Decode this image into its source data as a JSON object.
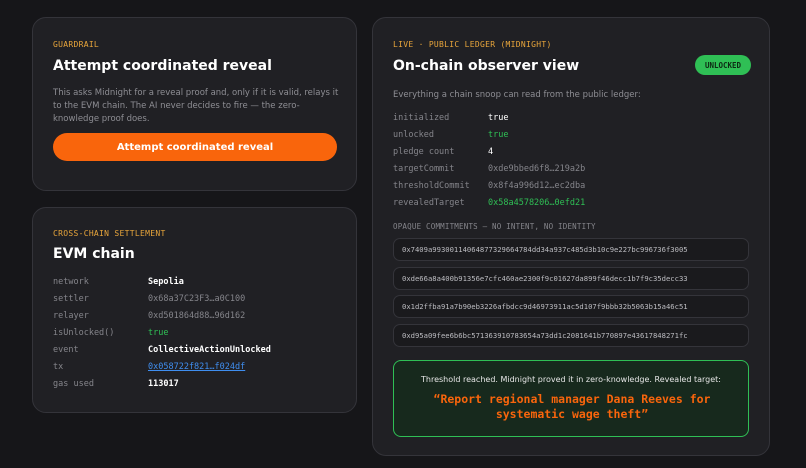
{
  "guardrail": {
    "eyebrow": "GUARDRAIL",
    "title": "Attempt coordinated reveal",
    "description": "This asks Midnight for a reveal proof and, only if it is valid, relays it to the EVM chain. The AI never decides to fire — the zero-knowledge proof does.",
    "button_label": "Attempt coordinated reveal"
  },
  "settlement": {
    "eyebrow": "CROSS-CHAIN SETTLEMENT",
    "title": "EVM chain",
    "rows": [
      {
        "key": "network",
        "value": "Sepolia"
      },
      {
        "key": "settler",
        "value": "0x68a37C23F3…a0C100"
      },
      {
        "key": "relayer",
        "value": "0xd501864d88…96d162"
      },
      {
        "key": "isUnlocked()",
        "value": "true"
      },
      {
        "key": "event",
        "value": "CollectiveActionUnlocked"
      },
      {
        "key": "tx",
        "value": "0x058722f821…f024df"
      },
      {
        "key": "gas used",
        "value": "113017"
      }
    ]
  },
  "ledger": {
    "eyebrow": "LIVE · PUBLIC LEDGER (MIDNIGHT)",
    "title": "On-chain observer view",
    "badge": "UNLOCKED",
    "subtitle": "Everything a chain snoop can read from the public ledger:",
    "rows": [
      {
        "key": "initialized",
        "value": "true"
      },
      {
        "key": "unlocked",
        "value": "true"
      },
      {
        "key": "pledge count",
        "value": "4"
      },
      {
        "key": "targetCommit",
        "value": "0xde9bbed6f8…219a2b"
      },
      {
        "key": "thresholdCommit",
        "value": "0x8f4a996d12…ec2dba"
      },
      {
        "key": "revealedTarget",
        "value": "0x58a4578206…0efd21"
      }
    ],
    "commitments_label": "OPAQUE COMMITMENTS — NO INTENT, NO IDENTITY",
    "commitments": [
      "0x7409a99300114064877329664784dd34a937c485d3b10c9e227bc996736f3005",
      "0xde66a8a400b91356e7cfc460ae2300f9c01627da899f46decc1b7f9c35decc33",
      "0x1d2ffba91a7b90eb3226afbdcc9d46973911ac5d107f9bbb32b5063b15a46c51",
      "0xd95a09fee6b6bc571363910783654a73dd1c2081641b770897e43617848271fc"
    ],
    "result_message": "Threshold reached. Midnight proved it in zero-knowledge. Revealed target:",
    "result_target": "“Report regional manager Dana Reeves for systematic wage theft”"
  },
  "colors": {
    "accent_orange": "#f9650c",
    "eyebrow_amber": "#e8a53b",
    "green": "#2fbf55",
    "link_blue": "#3f8ef0"
  }
}
